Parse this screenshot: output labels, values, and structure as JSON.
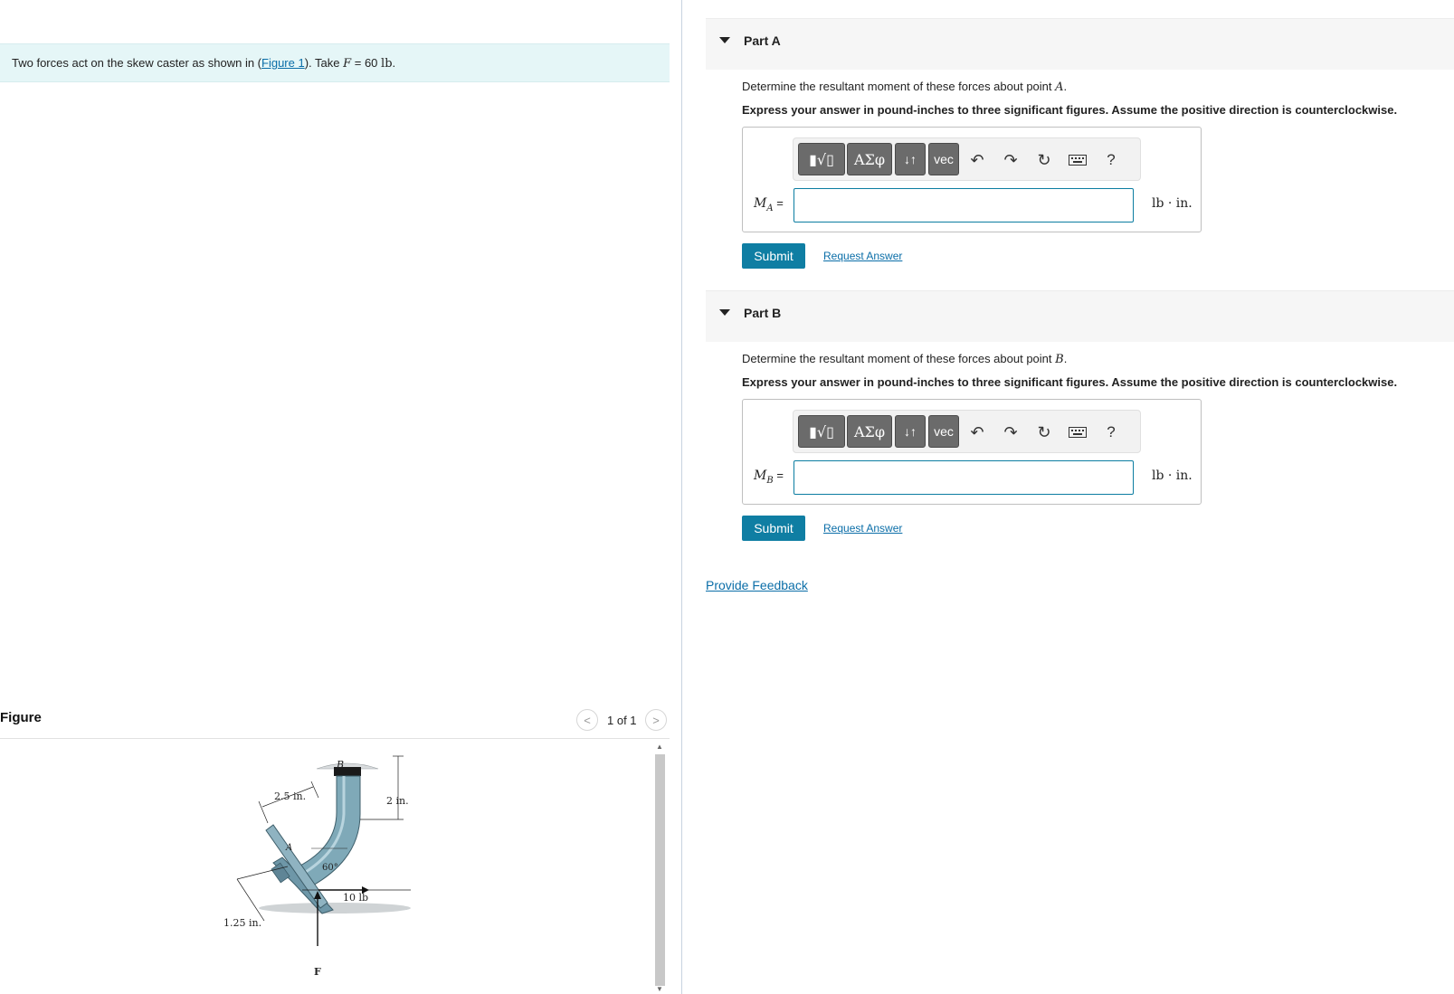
{
  "intro": {
    "text_before": "Two forces act on the skew caster as shown in (",
    "figure_link": "Figure 1",
    "text_after": "). Take ",
    "var": "F",
    "value": " = 60 ",
    "unit": "lb",
    "period": "."
  },
  "figure": {
    "title": "Figure",
    "counter": "1 of 1",
    "prev_icon": "chevron-left",
    "next_icon": "chevron-right",
    "labels": {
      "B": "B",
      "A": "A",
      "dim_25": "2.5 in.",
      "dim_2": "2 in.",
      "dim_125": "1.25 in.",
      "angle": "60°",
      "force_10": "10 lb",
      "force_F": "F"
    }
  },
  "parts": [
    {
      "title": "Part A",
      "question_prefix": "Determine the resultant moment of these forces about point ",
      "point": "A",
      "question_suffix": ".",
      "instruction": "Express your answer in pound-inches to three significant figures. Assume the positive direction is counterclockwise.",
      "var_main": "M",
      "var_sub": "A",
      "equals": " =",
      "unit": "lb · in.",
      "submit_label": "Submit",
      "request_label": "Request Answer",
      "toolbar": {
        "templates": "▮√▯",
        "greek": "ΑΣφ",
        "arrows": "↓↑",
        "vec": "vec",
        "help": "?"
      }
    },
    {
      "title": "Part B",
      "question_prefix": "Determine the resultant moment of these forces about point ",
      "point": "B",
      "question_suffix": ".",
      "instruction": "Express your answer in pound-inches to three significant figures. Assume the positive direction is counterclockwise.",
      "var_main": "M",
      "var_sub": "B",
      "equals": " =",
      "unit": "lb · in.",
      "submit_label": "Submit",
      "request_label": "Request Answer",
      "toolbar": {
        "templates": "▮√▯",
        "greek": "ΑΣφ",
        "arrows": "↓↑",
        "vec": "vec",
        "help": "?"
      }
    }
  ],
  "feedback_label": "Provide Feedback"
}
